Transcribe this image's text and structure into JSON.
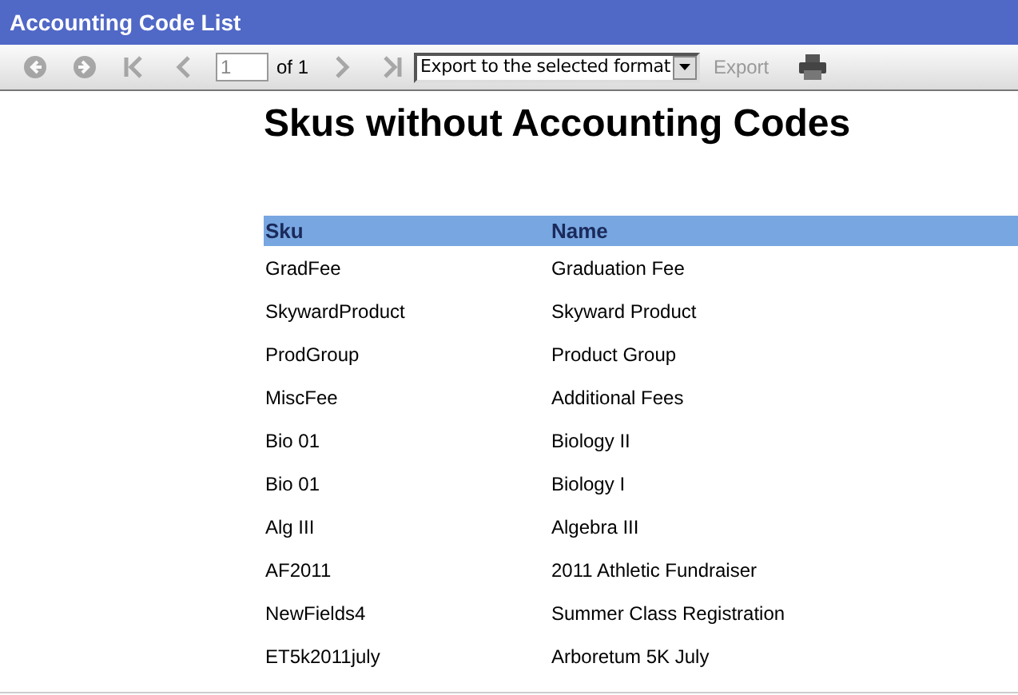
{
  "window": {
    "title": "Accounting Code List"
  },
  "toolbar": {
    "nav_buttons": [
      {
        "kind": "back",
        "disabled": true
      },
      {
        "kind": "forward",
        "disabled": true
      },
      {
        "kind": "first",
        "disabled": true
      },
      {
        "kind": "previous",
        "disabled": true
      }
    ],
    "page": "1",
    "page_count": "of 1",
    "nav_buttons_after": [
      {
        "kind": "next",
        "disabled": true
      },
      {
        "kind": "last",
        "disabled": true
      }
    ],
    "export_format": "Export to the selected format",
    "export_button": {
      "label": "Export",
      "disabled": true
    }
  },
  "report": {
    "title": "Skus without Accounting Codes",
    "table": {
      "columns": [
        "Sku",
        "Name"
      ],
      "rows": [
        [
          "GradFee",
          "Graduation Fee"
        ],
        [
          "SkywardProduct",
          "Skyward Product"
        ],
        [
          "ProdGroup",
          "Product Group"
        ],
        [
          "MiscFee",
          "Additional Fees"
        ],
        [
          "Bio 01",
          "Biology II"
        ],
        [
          "Bio 01",
          "Biology I"
        ],
        [
          "Alg III",
          "Algebra III"
        ],
        [
          "AF2011",
          "2011 Athletic Fundraiser"
        ],
        [
          "NewFields4",
          "Summer Class Registration"
        ],
        [
          "ET5k2011july",
          "Arboretum 5K July"
        ]
      ]
    }
  }
}
